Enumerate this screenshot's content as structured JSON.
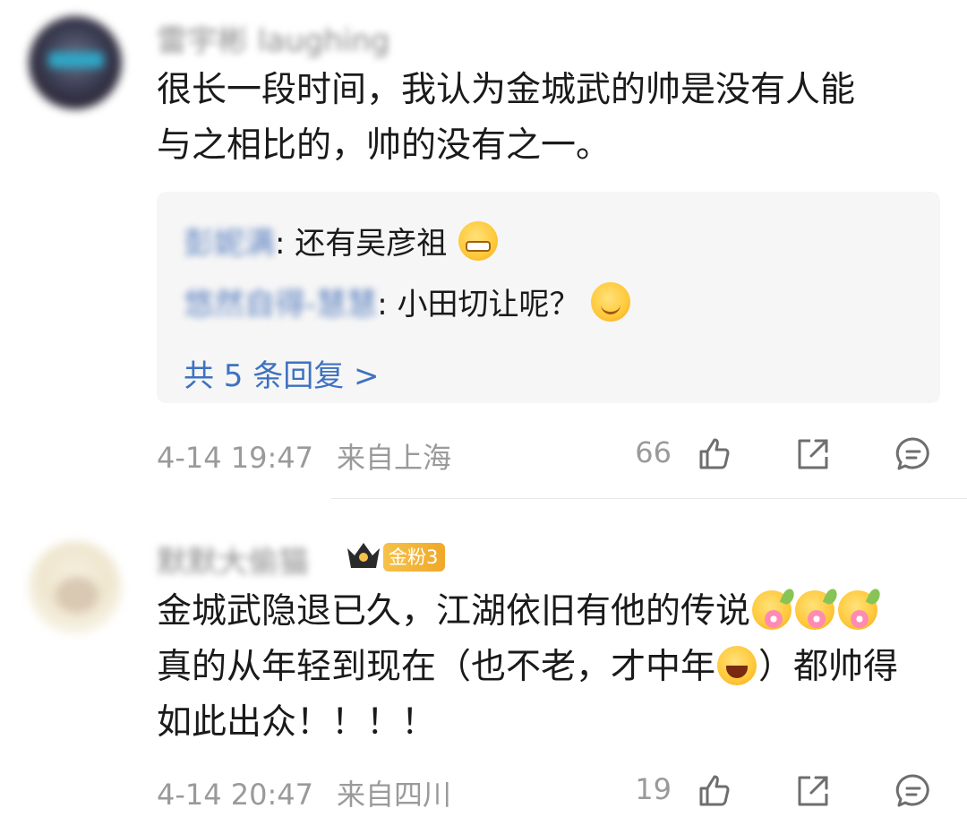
{
  "comments": [
    {
      "username": "雷宇彬 laughing",
      "text_line1": "很长一段时间，我认为金城武的帅是没有人能",
      "text_line2": "与之相比的，帅的没有之一。",
      "replies": [
        {
          "name": "彭妮满",
          "text": ": 还有吴彦祖",
          "emoji": "grin-emoji"
        },
        {
          "name": "悠然自得-慧慧",
          "text": ": 小田切让呢？",
          "emoji": "smile-emoji"
        }
      ],
      "more_replies": "共 5 条回复 >",
      "time": "4-14 19:47",
      "location": "来自上海",
      "likes": "66"
    },
    {
      "username": "默默大偷猫",
      "badge": "金粉3",
      "text_line1": "金城武隐退已久，江湖依旧有他的传说",
      "text_line2a": "真的从年轻到现在（也不老，才中年",
      "text_line2b": "）都帅得",
      "text_line3": "如此出众！！！！",
      "time": "4-14 20:47",
      "location": "来自四川",
      "likes": "19"
    }
  ],
  "colors": {
    "link": "#3d72c0",
    "meta": "#9a9a9a",
    "reply_bg": "#f6f6f6",
    "badge": "#f0a82a"
  }
}
